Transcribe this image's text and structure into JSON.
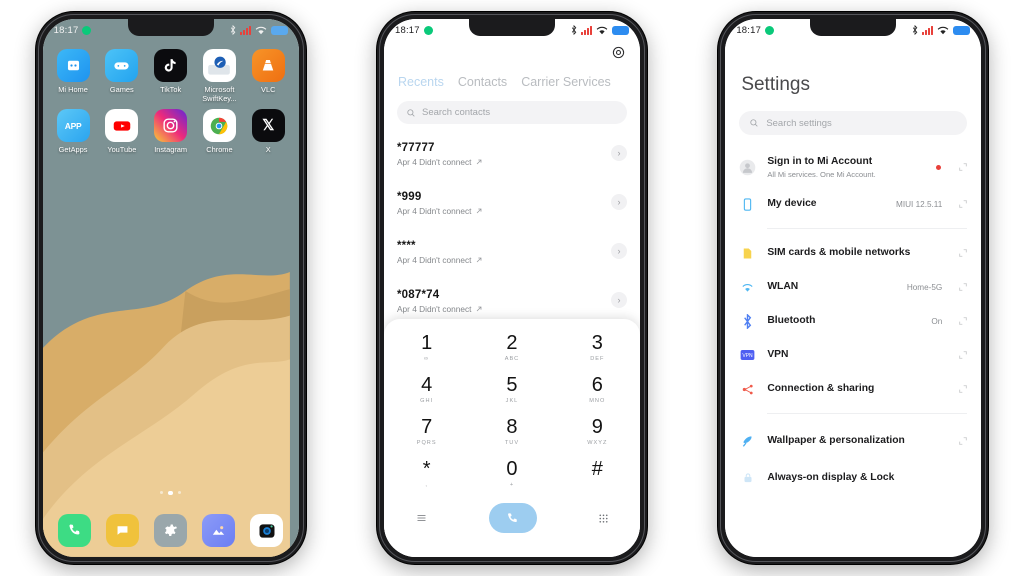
{
  "statusbar": {
    "time": "18:17",
    "icons": [
      "bluetooth-icon",
      "signal-bars-icon",
      "wifi-icon",
      "battery-icon"
    ]
  },
  "phone1": {
    "name": "home-screen",
    "wallpaper": {
      "sky_color": "#7d9294",
      "dune_light": "#e8c88d",
      "dune_mid": "#dcb36d",
      "dune_dark": "#c9a05e"
    },
    "apps_row1": [
      {
        "label": "Mi Home",
        "icon": "mi-home-icon",
        "color": "#29a9f5"
      },
      {
        "label": "Games",
        "icon": "games-controller-icon",
        "color": "#3ab4f2"
      },
      {
        "label": "TikTok",
        "icon": "tiktok-icon",
        "color": "#0b0b0e"
      },
      {
        "label": "Microsoft SwiftKey...",
        "icon": "swiftkey-icon",
        "color": "#ffffff"
      },
      {
        "label": "VLC",
        "icon": "vlc-cone-icon",
        "color": "#f07c1a"
      }
    ],
    "apps_row2": [
      {
        "label": "GetApps",
        "icon": "getapps-icon",
        "color": "#3ab4f2"
      },
      {
        "label": "YouTube",
        "icon": "youtube-icon",
        "color": "#ffffff"
      },
      {
        "label": "Instagram",
        "icon": "instagram-icon",
        "color": "#d62976"
      },
      {
        "label": "Chrome",
        "icon": "chrome-icon",
        "color": "#ffffff"
      },
      {
        "label": "X",
        "icon": "x-twitter-icon",
        "color": "#0b0b0e"
      }
    ],
    "dock": [
      {
        "name": "phone-app",
        "icon": "phone-handset-icon",
        "color": "#3ddc84"
      },
      {
        "name": "messages-app",
        "icon": "message-bubble-icon",
        "color": "#f0c23c"
      },
      {
        "name": "settings-app",
        "icon": "gear-icon",
        "color": "#9aa7ab"
      },
      {
        "name": "gallery-app",
        "icon": "photo-mountain-icon",
        "color": "#7b8cf5"
      },
      {
        "name": "camera-app",
        "icon": "camera-lens-icon",
        "color": "#ffffff"
      }
    ],
    "page_indicator": {
      "count": 3,
      "active": 1
    }
  },
  "phone2": {
    "name": "dialer-screen",
    "settings_icon": "gear-icon",
    "tabs": [
      {
        "label": "Recents",
        "active": true
      },
      {
        "label": "Contacts",
        "active": false
      },
      {
        "label": "Carrier Services",
        "active": false
      }
    ],
    "search": {
      "placeholder": "Search contacts",
      "icon": "search-icon"
    },
    "calls": [
      {
        "number": "*77777",
        "detail": "Apr 4 Didn't connect",
        "status_icon": "outgoing-arrow-icon"
      },
      {
        "number": "*999",
        "detail": "Apr 4 Didn't connect",
        "status_icon": "outgoing-arrow-icon"
      },
      {
        "number": "****",
        "detail": "Apr 4 Didn't connect",
        "status_icon": "outgoing-arrow-icon"
      },
      {
        "number": "*087*74",
        "detail": "Apr 4 Didn't connect",
        "status_icon": "outgoing-arrow-icon"
      }
    ],
    "keypad": [
      {
        "num": "1",
        "sub": "∞"
      },
      {
        "num": "2",
        "sub": "ABC"
      },
      {
        "num": "3",
        "sub": "DEF"
      },
      {
        "num": "4",
        "sub": "GHI"
      },
      {
        "num": "5",
        "sub": "JKL"
      },
      {
        "num": "6",
        "sub": "MNO"
      },
      {
        "num": "7",
        "sub": "PQRS"
      },
      {
        "num": "8",
        "sub": "TUV"
      },
      {
        "num": "9",
        "sub": "WXYZ"
      },
      {
        "num": "*",
        "sub": ","
      },
      {
        "num": "0",
        "sub": "+"
      },
      {
        "num": "#",
        "sub": ""
      }
    ],
    "bottom_bar": {
      "left_icon": "menu-lines-icon",
      "call_button_icon": "phone-handset-icon",
      "call_button_color": "#9dcdf0",
      "right_icon": "keypad-grid-icon"
    }
  },
  "phone3": {
    "name": "settings-screen",
    "title": "Settings",
    "search": {
      "placeholder": "Search settings",
      "icon": "search-icon"
    },
    "items": [
      {
        "label": "Sign in to Mi Account",
        "sub": "All Mi services. One Mi Account.",
        "value": "",
        "icon": "account-avatar-icon",
        "badge": true
      },
      {
        "label": "My device",
        "sub": "",
        "value": "MIUI 12.5.11",
        "icon": "device-phone-icon",
        "badge": false
      },
      {
        "label": "SIM cards & mobile networks",
        "sub": "",
        "value": "",
        "icon": "sim-card-icon",
        "badge": false
      },
      {
        "label": "WLAN",
        "sub": "",
        "value": "Home-5G",
        "icon": "wifi-icon",
        "badge": false
      },
      {
        "label": "Bluetooth",
        "sub": "",
        "value": "On",
        "icon": "bluetooth-icon",
        "badge": false
      },
      {
        "label": "VPN",
        "sub": "",
        "value": "",
        "icon": "vpn-badge-icon",
        "badge": false
      },
      {
        "label": "Connection & sharing",
        "sub": "",
        "value": "",
        "icon": "share-nodes-icon",
        "badge": false
      },
      {
        "label": "Wallpaper & personalization",
        "sub": "",
        "value": "",
        "icon": "wallpaper-icon",
        "badge": false
      },
      {
        "label": "Always-on display & Lock",
        "sub": "",
        "value": "",
        "icon": "lock-display-icon",
        "badge": false
      }
    ],
    "dividers_after": [
      1,
      4,
      6
    ]
  }
}
